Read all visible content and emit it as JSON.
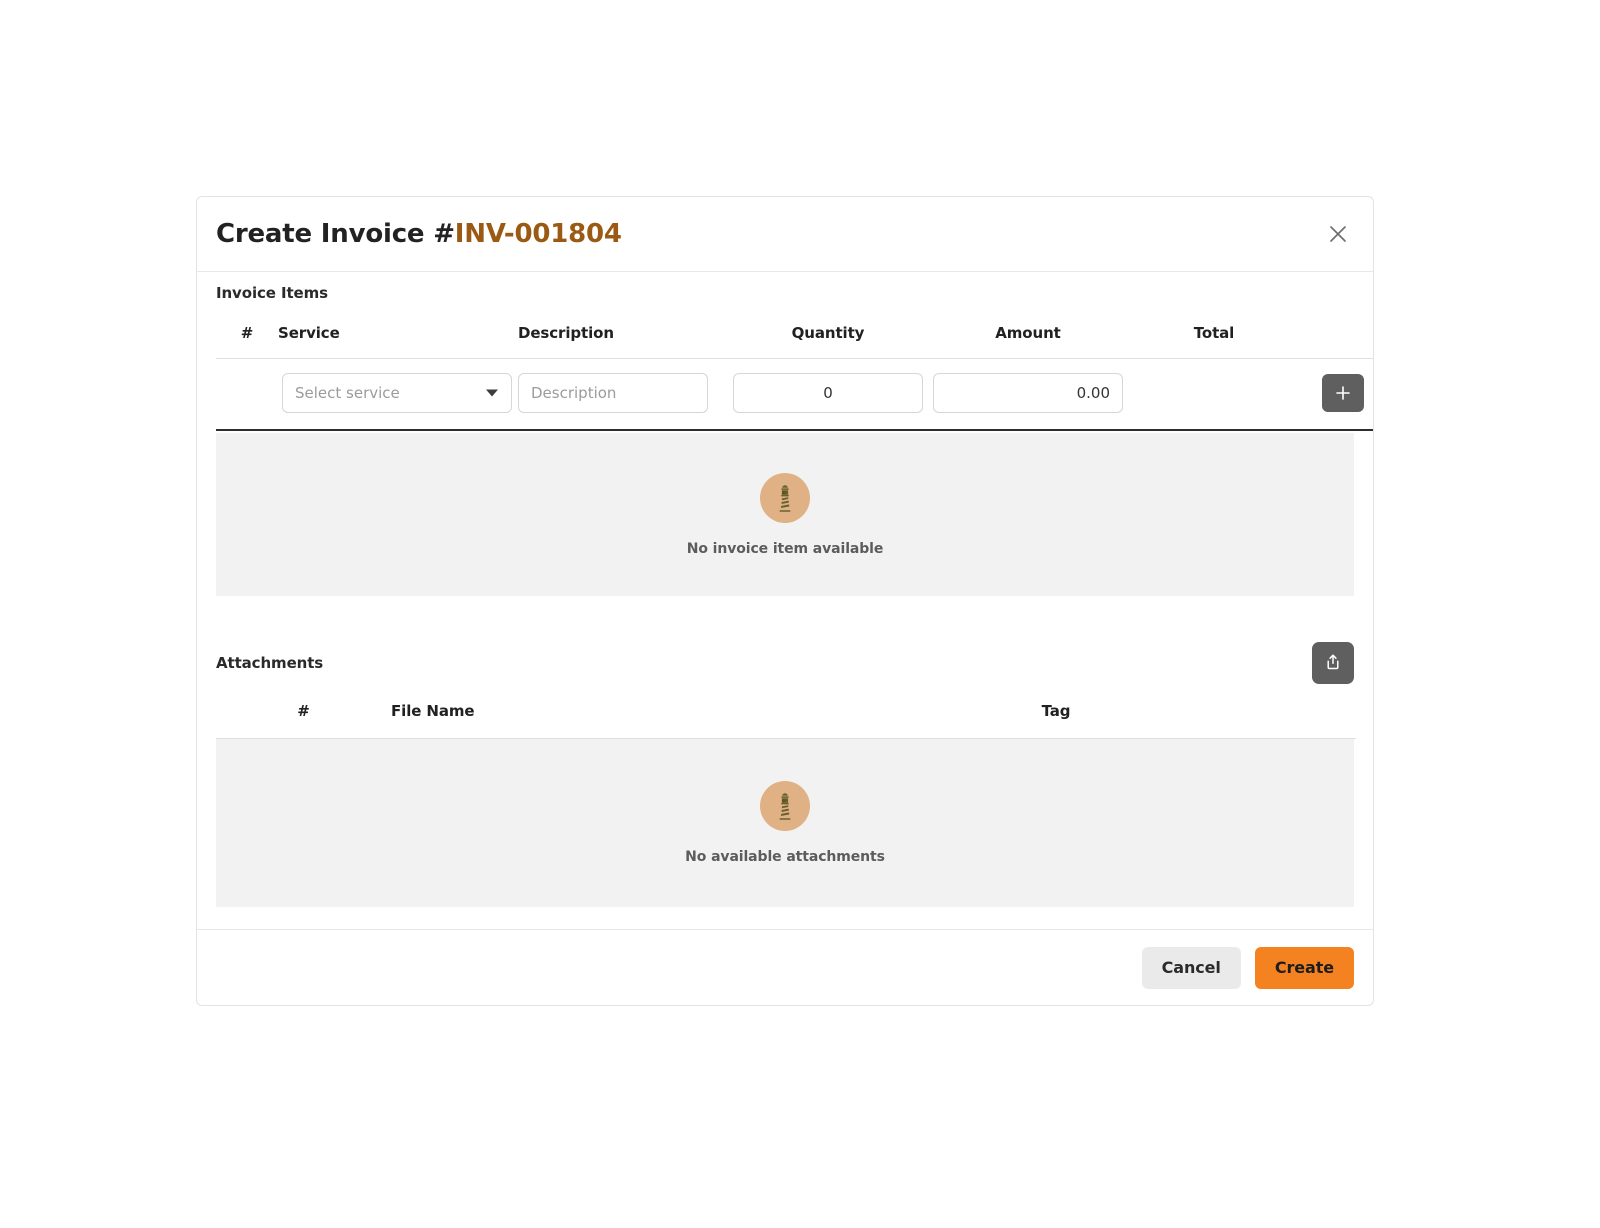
{
  "dialog": {
    "title_prefix": "Create Invoice #",
    "invoice_number": "INV-001804",
    "close_icon": "close-icon"
  },
  "invoice_items": {
    "section_label": "Invoice Items",
    "columns": {
      "num": "#",
      "service": "Service",
      "description": "Description",
      "quantity": "Quantity",
      "amount": "Amount",
      "total": "Total"
    },
    "entry_row": {
      "service_value": "Select service",
      "description_placeholder": "Description",
      "quantity_value": "0",
      "amount_value": "0.00",
      "add_icon": "plus-icon"
    },
    "empty": {
      "icon": "lighthouse-icon",
      "text": "No invoice item available"
    }
  },
  "attachments": {
    "section_label": "Attachments",
    "upload_icon": "upload-icon",
    "columns": {
      "num": "#",
      "file_name": "File Name",
      "tag": "Tag"
    },
    "empty": {
      "icon": "lighthouse-icon",
      "text": "No available attachments"
    }
  },
  "footer": {
    "cancel_label": "Cancel",
    "create_label": "Create"
  },
  "colors": {
    "accent_orange": "#f58220",
    "invoice_number": "#9a5a13",
    "icon_button": "#5f5f5f",
    "empty_bg": "#f2f2f2",
    "empty_icon_circle": "#e0b184"
  }
}
